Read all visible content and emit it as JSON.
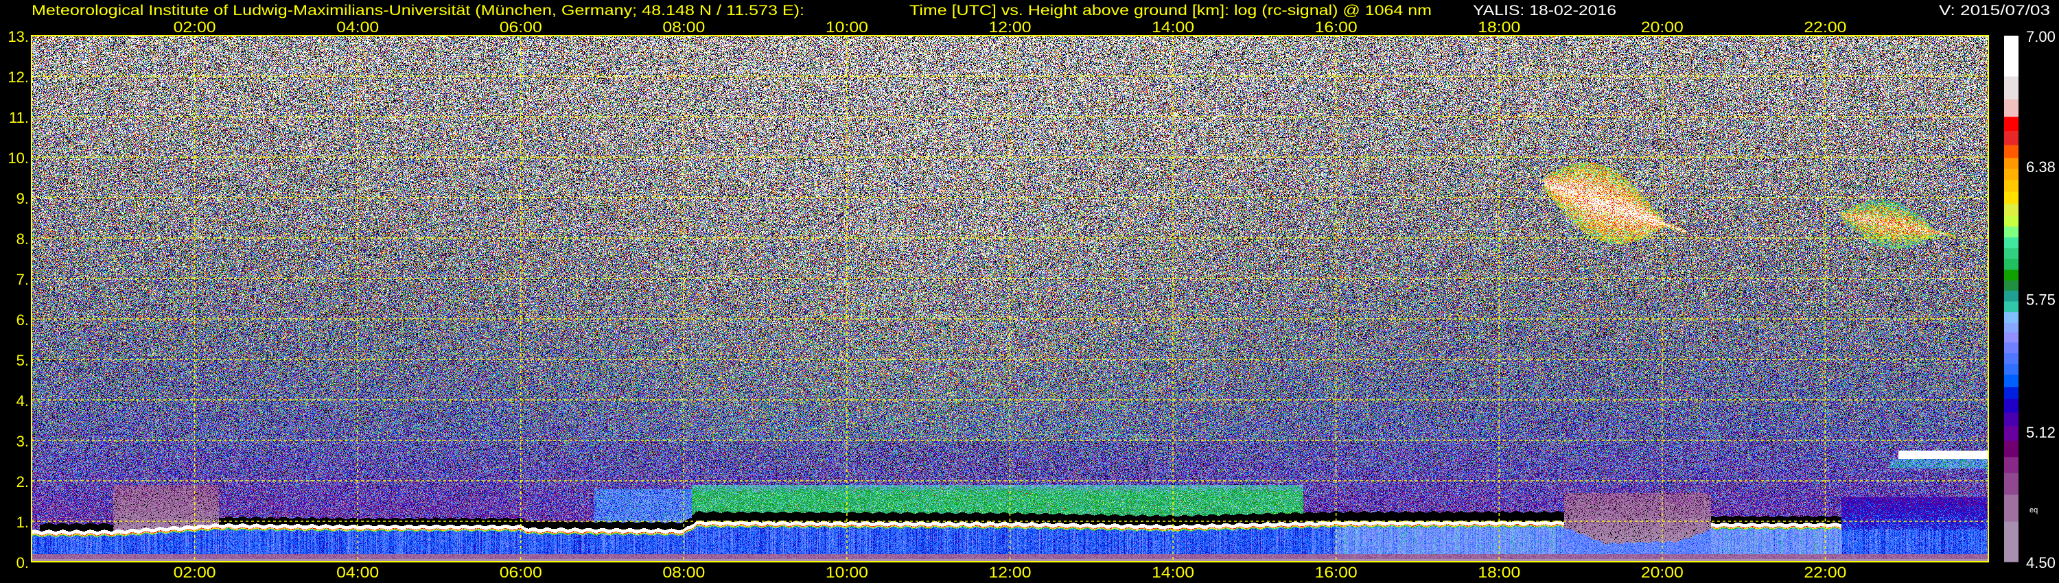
{
  "header": {
    "institute": "Meteorological Institute of Ludwig-Maximilians-Universität (München, Germany; 48.148 N / 11.573 E):",
    "description": "Time [UTC] vs. Height above ground [km]: log (rc-signal) @ 1064 nm",
    "instrument_date": "YALIS: 18-02-2016",
    "version": "V: 2015/07/03"
  },
  "colors": {
    "axis_text": "#ffff00",
    "info_text": "#ffffff",
    "grid": "#ffff00",
    "background": "#000000"
  },
  "chart_data": {
    "type": "heatmap",
    "title": "Time [UTC] vs. Height above ground [km]: log (rc-signal) @ 1064 nm",
    "xlabel": "Time [UTC]",
    "ylabel": "Height above ground [km]",
    "xlim": [
      0,
      24
    ],
    "ylim": [
      0,
      13
    ],
    "x_ticks": [
      {
        "value": 2,
        "label": "02:00"
      },
      {
        "value": 4,
        "label": "04:00"
      },
      {
        "value": 6,
        "label": "06:00"
      },
      {
        "value": 8,
        "label": "08:00"
      },
      {
        "value": 10,
        "label": "10:00"
      },
      {
        "value": 12,
        "label": "12:00"
      },
      {
        "value": 14,
        "label": "14:00"
      },
      {
        "value": 16,
        "label": "16:00"
      },
      {
        "value": 18,
        "label": "18:00"
      },
      {
        "value": 20,
        "label": "20:00"
      },
      {
        "value": 22,
        "label": "22:00"
      }
    ],
    "y_ticks": [
      {
        "value": 0,
        "label": "0."
      },
      {
        "value": 1,
        "label": "1."
      },
      {
        "value": 2,
        "label": "2."
      },
      {
        "value": 3,
        "label": "3."
      },
      {
        "value": 4,
        "label": "4."
      },
      {
        "value": 5,
        "label": "5."
      },
      {
        "value": 6,
        "label": "6."
      },
      {
        "value": 7,
        "label": "7."
      },
      {
        "value": 8,
        "label": "8."
      },
      {
        "value": 9,
        "label": "9."
      },
      {
        "value": 10,
        "label": "10."
      },
      {
        "value": 11,
        "label": "11."
      },
      {
        "value": 12,
        "label": "12."
      },
      {
        "value": 13,
        "label": "13."
      }
    ],
    "grid": true,
    "colorbar": {
      "range": [
        4.5,
        7.0
      ],
      "ticks": [
        {
          "value": 7.0,
          "label": "7.00"
        },
        {
          "value": 6.38,
          "label": "6.38"
        },
        {
          "value": 5.75,
          "label": "5.75"
        },
        {
          "value": 5.12,
          "label": "5.12"
        },
        {
          "value": 4.5,
          "label": "4.50"
        }
      ],
      "unit_label": "eq",
      "placement": "right"
    },
    "features": {
      "boundary_layer_top_km": [
        [
          0,
          0.72
        ],
        [
          1,
          0.72
        ],
        [
          2.3,
          0.88
        ],
        [
          4,
          0.85
        ],
        [
          6,
          0.85
        ],
        [
          6.1,
          0.78
        ],
        [
          8,
          0.75
        ],
        [
          8.15,
          0.95
        ],
        [
          12,
          0.92
        ],
        [
          14,
          0.85
        ],
        [
          16,
          0.95
        ],
        [
          18.8,
          0.95
        ],
        [
          19.3,
          0.55
        ],
        [
          20.2,
          0.6
        ],
        [
          20.6,
          0.9
        ],
        [
          22.2,
          0.9
        ],
        [
          24,
          0.9
        ]
      ],
      "residual_aerosol_layer": {
        "time_h": [
          8.1,
          15.6
        ],
        "height_km": [
          1.1,
          1.9
        ],
        "level": 5.85
      },
      "cirrus_clouds": [
        {
          "time_h": [
            18.55,
            20.3
          ],
          "height_km": [
            7.8,
            9.7
          ],
          "level": 6.9
        },
        {
          "time_h": [
            22.2,
            23.6
          ],
          "height_km": [
            7.7,
            8.9
          ],
          "level": 6.6
        }
      ],
      "low_cloud": {
        "time_h": [
          22.9,
          24
        ],
        "height_km": [
          2.55,
          2.75
        ],
        "level": 7.0
      }
    }
  }
}
